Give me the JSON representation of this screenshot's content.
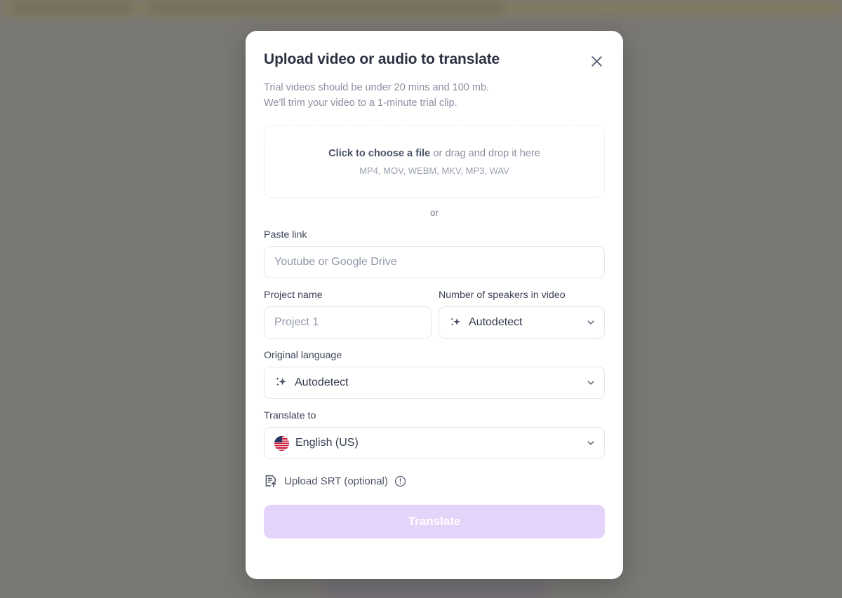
{
  "modal": {
    "title": "Upload video or audio to translate",
    "subtitle_line1": "Trial videos should be under 20 mins and 100 mb.",
    "subtitle_line2": "We'll trim your video to a 1-minute trial clip.",
    "close_icon": "close-icon"
  },
  "dropzone": {
    "cta_bold": "Click to choose a file",
    "cta_rest": " or drag and drop it here",
    "formats": "MP4, MOV, WEBM, MKV, MP3, WAV"
  },
  "separator": {
    "text": "or"
  },
  "paste_link": {
    "label": "Paste link",
    "placeholder": "Youtube or Google Drive",
    "value": ""
  },
  "project_name": {
    "label": "Project name",
    "placeholder": "Project 1",
    "value": ""
  },
  "speakers": {
    "label": "Number of speakers in video",
    "value": "Autodetect",
    "icon": "sparkle-icon",
    "chevron": "chevron-down-icon"
  },
  "original_language": {
    "label": "Original language",
    "value": "Autodetect",
    "icon": "sparkle-icon",
    "chevron": "chevron-down-icon"
  },
  "translate_to": {
    "label": "Translate to",
    "value": "English (US)",
    "icon": "us-flag-icon",
    "chevron": "chevron-down-icon"
  },
  "srt": {
    "label": "Upload SRT (optional)",
    "upload_icon": "document-upload-icon",
    "info_icon": "info-circle-icon"
  },
  "submit": {
    "label": "Translate",
    "enabled": false
  },
  "colors": {
    "modal_background": "#ffffff",
    "overlay": "#7e7c79",
    "title_text": "#2b3142",
    "muted_text": "#8b90a0",
    "border": "#e6e7ec",
    "button_disabled": "#e5d4f9",
    "button_text": "#ffffff"
  }
}
